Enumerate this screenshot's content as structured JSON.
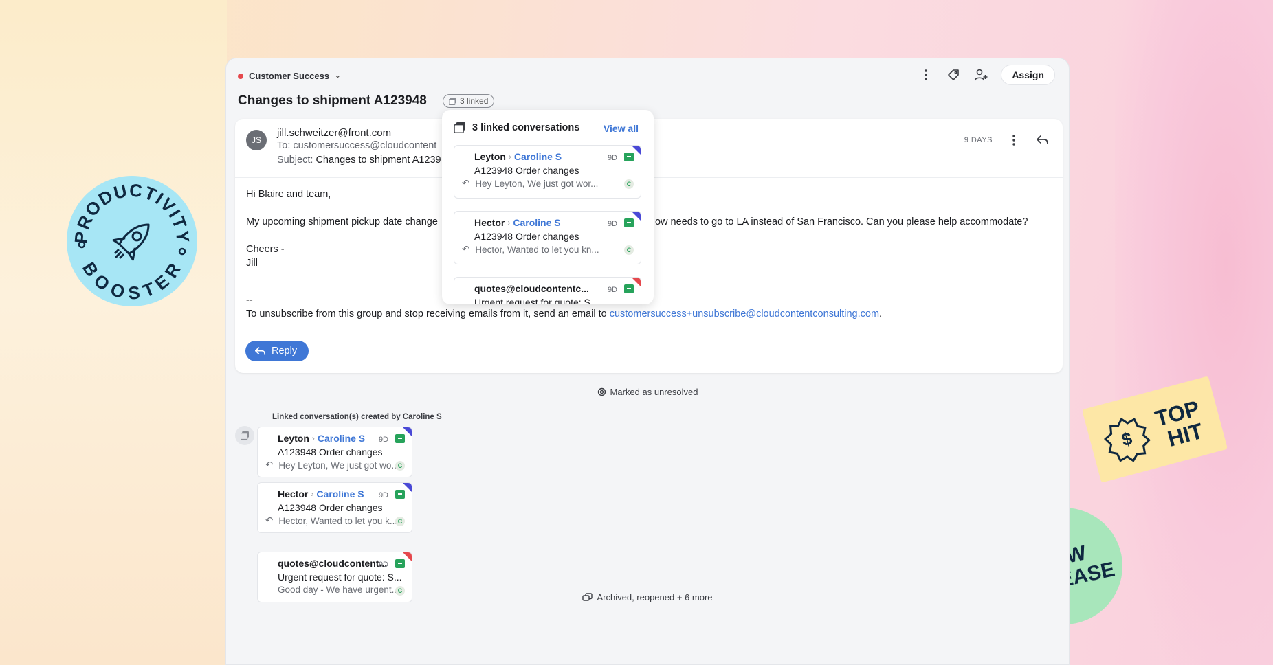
{
  "inbox": {
    "name": "Customer Success"
  },
  "toolbar": {
    "assign_label": "Assign"
  },
  "conversation": {
    "title": "Changes to shipment A123948",
    "linked_pill": "3 linked"
  },
  "message": {
    "avatar_initials": "JS",
    "from": "jill.schweitzer@front.com",
    "to_label": "To:",
    "to": "customersuccess@cloudcontent",
    "subject_label": "Subject:",
    "subject": "Changes to shipment A1239",
    "age": "9 DAYS",
    "greeting": "Hi Blaire and team,",
    "body_start": "My upcoming shipment pickup date change",
    "body_end": "now needs to go to LA instead of San Francisco. Can you please help accommodate?",
    "signoff": "Cheers -",
    "signature": "Jill",
    "separator": "--",
    "unsubscribe_text": "To unsubscribe from this group and stop receiving emails from it, send an email to",
    "unsubscribe_email": "customersuccess+unsubscribe@cloudcontentconsulting.com",
    "unsubscribe_end": ".",
    "reply_label": "Reply"
  },
  "timeline": {
    "status": "Marked as unresolved",
    "linked_label": "Linked conversation(s) created by Caroline S",
    "bottom": "Archived, reopened + 6 more"
  },
  "linked_list": [
    {
      "name": "Leyton",
      "assignee": "Caroline S",
      "age": "9D",
      "subject": "A123948 Order changes",
      "preview": "Hey Leyton, We just got wo...",
      "badge": "C",
      "corner": "blue"
    },
    {
      "name": "Hector",
      "assignee": "Caroline S",
      "age": "9D",
      "subject": "A123948 Order changes",
      "preview": "Hector, Wanted to let you k...",
      "badge": "C",
      "corner": "blue"
    },
    {
      "name": "quotes@cloudcontent...",
      "assignee": "",
      "age": "9D",
      "subject": "Urgent request for quote: S...",
      "preview": "Good day - We have urgent...",
      "badge": "C",
      "corner": "red"
    }
  ],
  "popover": {
    "title": "3 linked conversations",
    "view_all": "View all",
    "items": [
      {
        "name": "Leyton",
        "assignee": "Caroline S",
        "age": "9D",
        "subject": "A123948 Order changes",
        "preview": "Hey Leyton, We just got wor...",
        "badge": "C"
      },
      {
        "name": "Hector",
        "assignee": "Caroline S",
        "age": "9D",
        "subject": "A123948 Order changes",
        "preview": "Hector, Wanted to let you kn...",
        "badge": "C"
      },
      {
        "name": "quotes@cloudcontentc...",
        "age": "9D",
        "subject": "Urgent request for quote: S...",
        "badge": ""
      }
    ]
  },
  "stickers": {
    "productivity_top": "PRODUCTIVITY",
    "productivity_bottom": "BOOSTER",
    "top_hit_1": "TOP",
    "top_hit_2": "HIT",
    "new_release_1": "NEW",
    "new_release_2": "RELEASE"
  },
  "colors": {
    "accent": "#3f77d6",
    "archive_green": "#27a35b",
    "inbox_dot": "#e5484d",
    "tag_blue": "#4a49d6",
    "tag_red": "#e5484d"
  }
}
